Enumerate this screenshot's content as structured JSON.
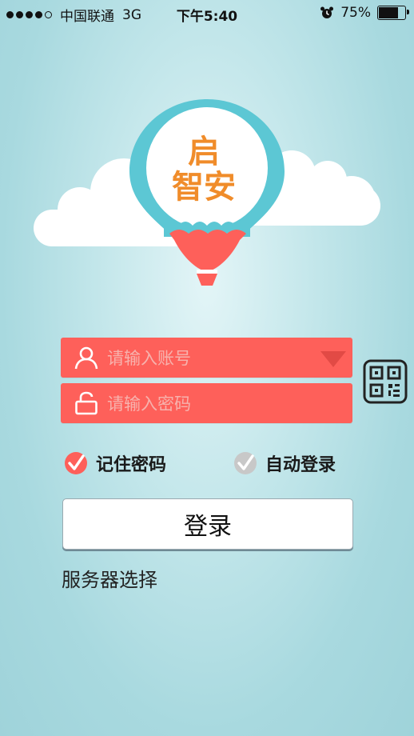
{
  "status_bar": {
    "carrier": "中国联通",
    "network": "3G",
    "time": "下午5:40",
    "battery_percent": "75%",
    "battery_level": 0.75
  },
  "logo": {
    "text_line1": "启",
    "text_line2": "智安"
  },
  "login_form": {
    "account_placeholder": "请输入账号",
    "password_placeholder": "请输入密码",
    "remember_password_label": "记住密码",
    "remember_password_checked": true,
    "auto_login_label": "自动登录",
    "auto_login_checked": false,
    "login_button_label": "登录",
    "server_select_label": "服务器选择"
  },
  "icons": {
    "account": "user-icon",
    "password": "lock-icon",
    "dropdown": "triangle-down-icon",
    "qr": "qr-code-icon",
    "check": "check-icon",
    "alarm": "alarm-clock-icon"
  },
  "colors": {
    "field_bg": "#fe605a",
    "accent_orange": "#f08c2a",
    "balloon_teal": "#5cc7d4",
    "check_active": "#fe605a",
    "check_inactive": "#c8c8c8"
  }
}
